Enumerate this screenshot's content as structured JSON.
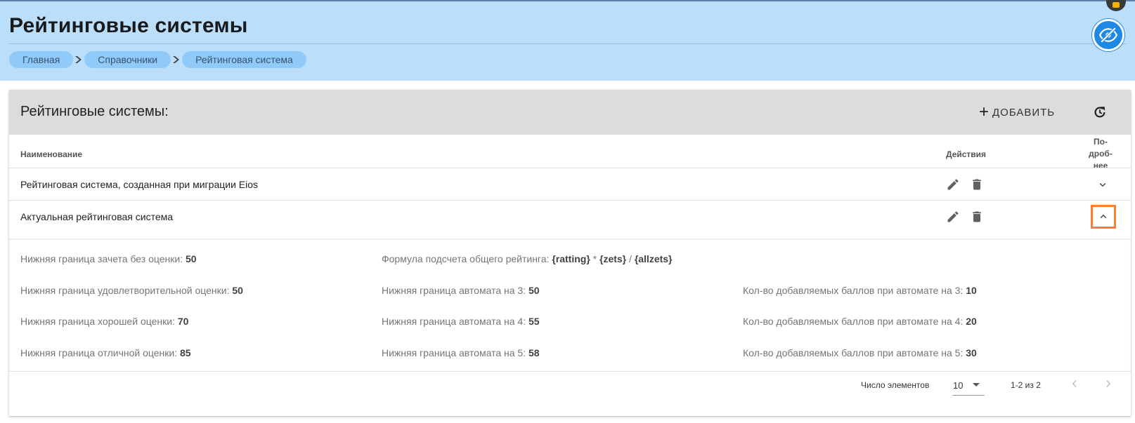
{
  "page": {
    "title": "Рейтинговые системы"
  },
  "breadcrumb": [
    "Главная",
    "Справочники",
    "Рейтинговая система"
  ],
  "toolbar": {
    "title": "Рейтинговые системы:",
    "add_label": "ДОБАВИТЬ"
  },
  "table": {
    "headers": {
      "name": "Наименование",
      "actions": "Действия",
      "more": [
        "По-",
        "дроб-",
        "нее"
      ]
    },
    "rows": [
      {
        "name": "Рейтинговая система, созданная при миграции Eios",
        "expanded": false
      },
      {
        "name": "Актуальная рейтинговая система",
        "expanded": true
      }
    ]
  },
  "details": [
    {
      "label": "Нижняя граница зачета без оценки:",
      "value": "50"
    },
    {
      "label": "Формула подсчета общего рейтинга:",
      "value_parts": [
        "{ratting}",
        "*",
        "{zets}",
        "/",
        "{allzets}"
      ]
    },
    {
      "label": "Нижняя граница удовлетворительной оценки:",
      "value": "50"
    },
    {
      "label": "Нижняя граница автомата на 3:",
      "value": "50"
    },
    {
      "label": "Кол-во добавляемых баллов при автомате на 3:",
      "value": "10"
    },
    {
      "label": "Нижняя граница хорошей оценки:",
      "value": "70"
    },
    {
      "label": "Нижняя граница автомата на 4:",
      "value": "55"
    },
    {
      "label": "Кол-во добавляемых баллов при автомате на 4:",
      "value": "20"
    },
    {
      "label": "Нижняя граница отличной оценки:",
      "value": "85"
    },
    {
      "label": "Нижняя граница автомата на 5:",
      "value": "58"
    },
    {
      "label": "Кол-во добавляемых баллов при автомате на 5:",
      "value": "30"
    }
  ],
  "pagination": {
    "items_per_page_label": "Число элементов",
    "items_per_page": "10",
    "range": "1-2 из 2"
  },
  "colors": {
    "header_bg": "#bbdefb",
    "crumb_bg": "#90caf9",
    "toolbar_bg": "#dcdcdc",
    "accent": "#1e88e5",
    "highlight": "#ff7f32"
  },
  "icons": [
    "eye-off-icon",
    "chevron-right-icon",
    "plus-icon",
    "refresh-icon",
    "pencil-icon",
    "trash-icon",
    "chevron-down-icon",
    "chevron-up-icon",
    "dropdown-arrow-icon",
    "chevron-left-icon"
  ]
}
